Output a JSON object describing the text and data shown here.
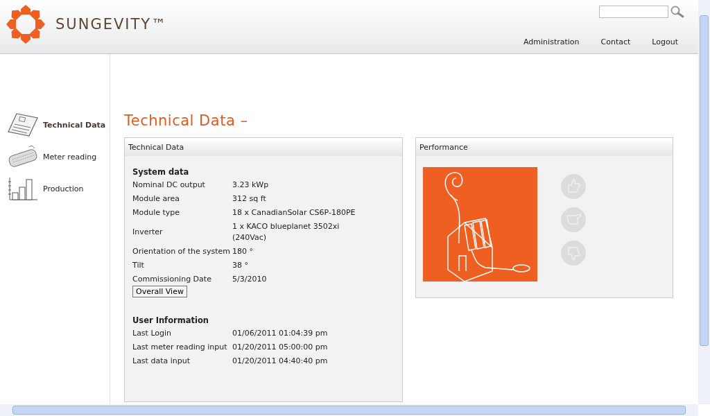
{
  "header": {
    "logo_text": "SUNGEVITY™",
    "nav": [
      "Administration",
      "Contact",
      "Logout"
    ]
  },
  "sidebar": {
    "items": [
      {
        "label": "Technical Data",
        "selected": true
      },
      {
        "label": "Meter reading",
        "selected": false
      },
      {
        "label": "Production",
        "selected": false
      }
    ]
  },
  "page_title": "Technical Data –",
  "technical_panel": {
    "title": "Technical Data",
    "system_heading": "System data",
    "system_rows": [
      {
        "label": "Nominal DC output",
        "value": "3.23 kWp"
      },
      {
        "label": "Module area",
        "value": "312 sq ft"
      },
      {
        "label": "Module type",
        "value": "18 x CanadianSolar CS6P-180PE"
      },
      {
        "label": "Inverter",
        "value": "1 x KACO blueplanet 3502xi (240Vac)"
      },
      {
        "label": "Orientation of the system",
        "value": "180 °"
      },
      {
        "label": "Tilt",
        "value": "38 °"
      },
      {
        "label": "Commissioning Date",
        "value": "5/3/2010"
      }
    ],
    "button": "Overall View",
    "user_heading": "User Information",
    "user_rows": [
      {
        "label": "Last Login",
        "value": "01/06/2011 01:04:39 pm"
      },
      {
        "label": "Last meter reading input",
        "value": "01/20/2011 05:00:00 pm"
      },
      {
        "label": "Last data input",
        "value": "01/20/2011 04:40:40 pm"
      }
    ]
  },
  "performance_panel": {
    "title": "Performance"
  }
}
